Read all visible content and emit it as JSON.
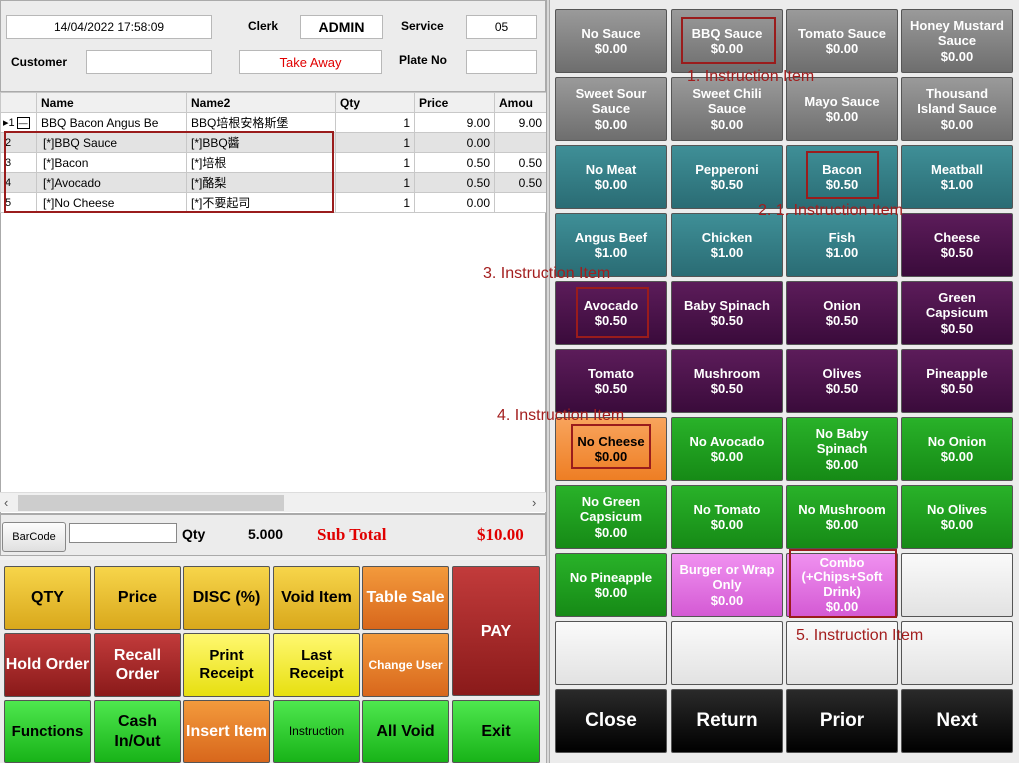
{
  "header": {
    "datetime": "14/04/2022 17:58:09",
    "clerk_label": "Clerk",
    "clerk_value": "ADMIN",
    "service_label": "Service",
    "service_value": "05",
    "customer_label": "Customer",
    "customer_value": "",
    "order_type": "Take Away",
    "plate_label": "Plate No",
    "plate_value": ""
  },
  "table": {
    "headers": [
      "Name",
      "Name2",
      "Qty",
      "Price",
      "Amou"
    ],
    "rows": [
      {
        "idx": "1",
        "name": "BBQ Bacon Angus Be",
        "name2": "BBQ培根安格斯堡",
        "qty": "1",
        "price": "9.00",
        "amount": "9.00"
      },
      {
        "idx": "2",
        "name": "[*]BBQ Sauce",
        "name2": "[*]BBQ醬",
        "qty": "1",
        "price": "0.00",
        "amount": ""
      },
      {
        "idx": "3",
        "name": "[*]Bacon",
        "name2": "[*]培根",
        "qty": "1",
        "price": "0.50",
        "amount": "0.50"
      },
      {
        "idx": "4",
        "name": "[*]Avocado",
        "name2": "[*]酪梨",
        "qty": "1",
        "price": "0.50",
        "amount": "0.50"
      },
      {
        "idx": "5",
        "name": "[*]No Cheese",
        "name2": "[*]不要起司",
        "qty": "1",
        "price": "0.00",
        "amount": ""
      }
    ]
  },
  "footer": {
    "barcode_label": "BarCode",
    "barcode_value": "",
    "qty_label": "Qty",
    "qty_value": "5.000",
    "subtotal_label": "Sub Total",
    "subtotal_value": "$10.00"
  },
  "left_buttons": {
    "qty": "QTY",
    "price": "Price",
    "disc": "DISC (%)",
    "void_item": "Void Item",
    "table_sale": "Table Sale",
    "pay": "PAY",
    "hold": "Hold Order",
    "recall": "Recall Order",
    "print": "Print Receipt",
    "last": "Last Receipt",
    "change_user": "Change User",
    "functions": "Functions",
    "cash": "Cash In/Out",
    "insert": "Insert Item",
    "instruction": "Instruction",
    "all_void": "All Void",
    "exit": "Exit"
  },
  "items": [
    {
      "name": "No Sauce",
      "price": "$0.00"
    },
    {
      "name": "BBQ Sauce",
      "price": "$0.00"
    },
    {
      "name": "Tomato Sauce",
      "price": "$0.00"
    },
    {
      "name": "Honey Mustard Sauce",
      "price": "$0.00"
    },
    {
      "name": "Sweet Sour Sauce",
      "price": "$0.00"
    },
    {
      "name": "Sweet Chili Sauce",
      "price": "$0.00"
    },
    {
      "name": "Mayo Sauce",
      "price": "$0.00"
    },
    {
      "name": "Thousand Island Sauce",
      "price": "$0.00"
    },
    {
      "name": "No Meat",
      "price": "$0.00"
    },
    {
      "name": "Pepperoni",
      "price": "$0.50"
    },
    {
      "name": "Bacon",
      "price": "$0.50"
    },
    {
      "name": "Meatball",
      "price": "$1.00"
    },
    {
      "name": "Angus Beef",
      "price": "$1.00"
    },
    {
      "name": "Chicken",
      "price": "$1.00"
    },
    {
      "name": "Fish",
      "price": "$1.00"
    },
    {
      "name": "Cheese",
      "price": "$0.50"
    },
    {
      "name": "Avocado",
      "price": "$0.50"
    },
    {
      "name": "Baby Spinach",
      "price": "$0.50"
    },
    {
      "name": "Onion",
      "price": "$0.50"
    },
    {
      "name": "Green Capsicum",
      "price": "$0.50"
    },
    {
      "name": "Tomato",
      "price": "$0.50"
    },
    {
      "name": "Mushroom",
      "price": "$0.50"
    },
    {
      "name": "Olives",
      "price": "$0.50"
    },
    {
      "name": "Pineapple",
      "price": "$0.50"
    },
    {
      "name": "No Cheese",
      "price": "$0.00"
    },
    {
      "name": "No Avocado",
      "price": "$0.00"
    },
    {
      "name": "No Baby Spinach",
      "price": "$0.00"
    },
    {
      "name": "No Onion",
      "price": "$0.00"
    },
    {
      "name": "No Green Capsicum",
      "price": "$0.00"
    },
    {
      "name": "No Tomato",
      "price": "$0.00"
    },
    {
      "name": "No Mushroom",
      "price": "$0.00"
    },
    {
      "name": "No Olives",
      "price": "$0.00"
    },
    {
      "name": "No Pineapple",
      "price": "$0.00"
    },
    {
      "name": "Burger or Wrap Only",
      "price": "$0.00"
    },
    {
      "name": "Combo (+Chips+Soft Drink)",
      "price": "$0.00"
    }
  ],
  "nav": {
    "close": "Close",
    "return": "Return",
    "prior": "Prior",
    "next": "Next"
  },
  "annotations": {
    "a1": "1. Instruction Item",
    "a2": "2. 1. Instruction Item",
    "a3": "3. Instruction Item",
    "a4": "4. Instruction Item",
    "a5": "5. Instruction Item"
  }
}
